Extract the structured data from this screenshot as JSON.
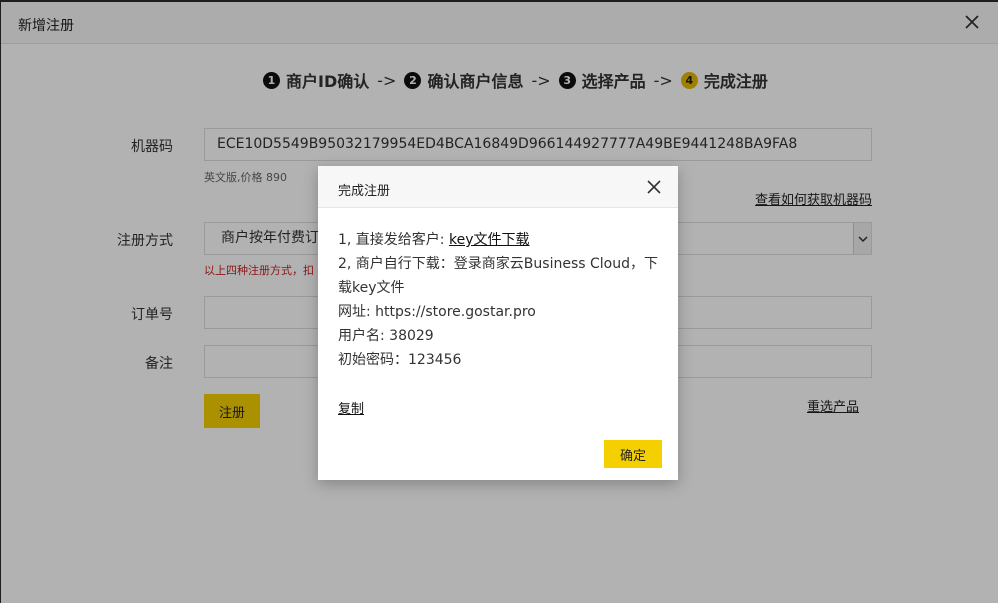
{
  "window": {
    "title": "新增注册"
  },
  "steps": [
    {
      "num": "1",
      "label": "商户ID确认"
    },
    {
      "num": "2",
      "label": "确认商户信息"
    },
    {
      "num": "3",
      "label": "选择产品"
    },
    {
      "num": "4",
      "label": "完成注册"
    }
  ],
  "step_arrow": "->",
  "form": {
    "machine_code_label": "机器码",
    "machine_code_value": "ECE10D5549B95032179954ED4BCA16849D966144927777A49BE9441248BA9FA8",
    "product_hint": "英文版,价格 890",
    "how_to_get_link": "查看如何获取机器码",
    "reg_method_label": "注册方式",
    "reg_method_value": "商户按年付费订",
    "reg_method_hint": "以上四种注册方式，扣",
    "order_label": "订单号",
    "remark_label": "备注",
    "register_button": "注册",
    "reselect_link": "重选产品"
  },
  "modal": {
    "title": "完成注册",
    "line1_prefix": "1, 直接发给客户: ",
    "line1_link": "key文件下载",
    "line2": "2, 商户自行下载：登录商家云Business Cloud，下载key文件",
    "line3": "网址: https://store.gostar.pro",
    "line4": "用户名: 38029",
    "line5": "初始密码：123456",
    "copy_link": "复制",
    "ok_button": "确定"
  }
}
